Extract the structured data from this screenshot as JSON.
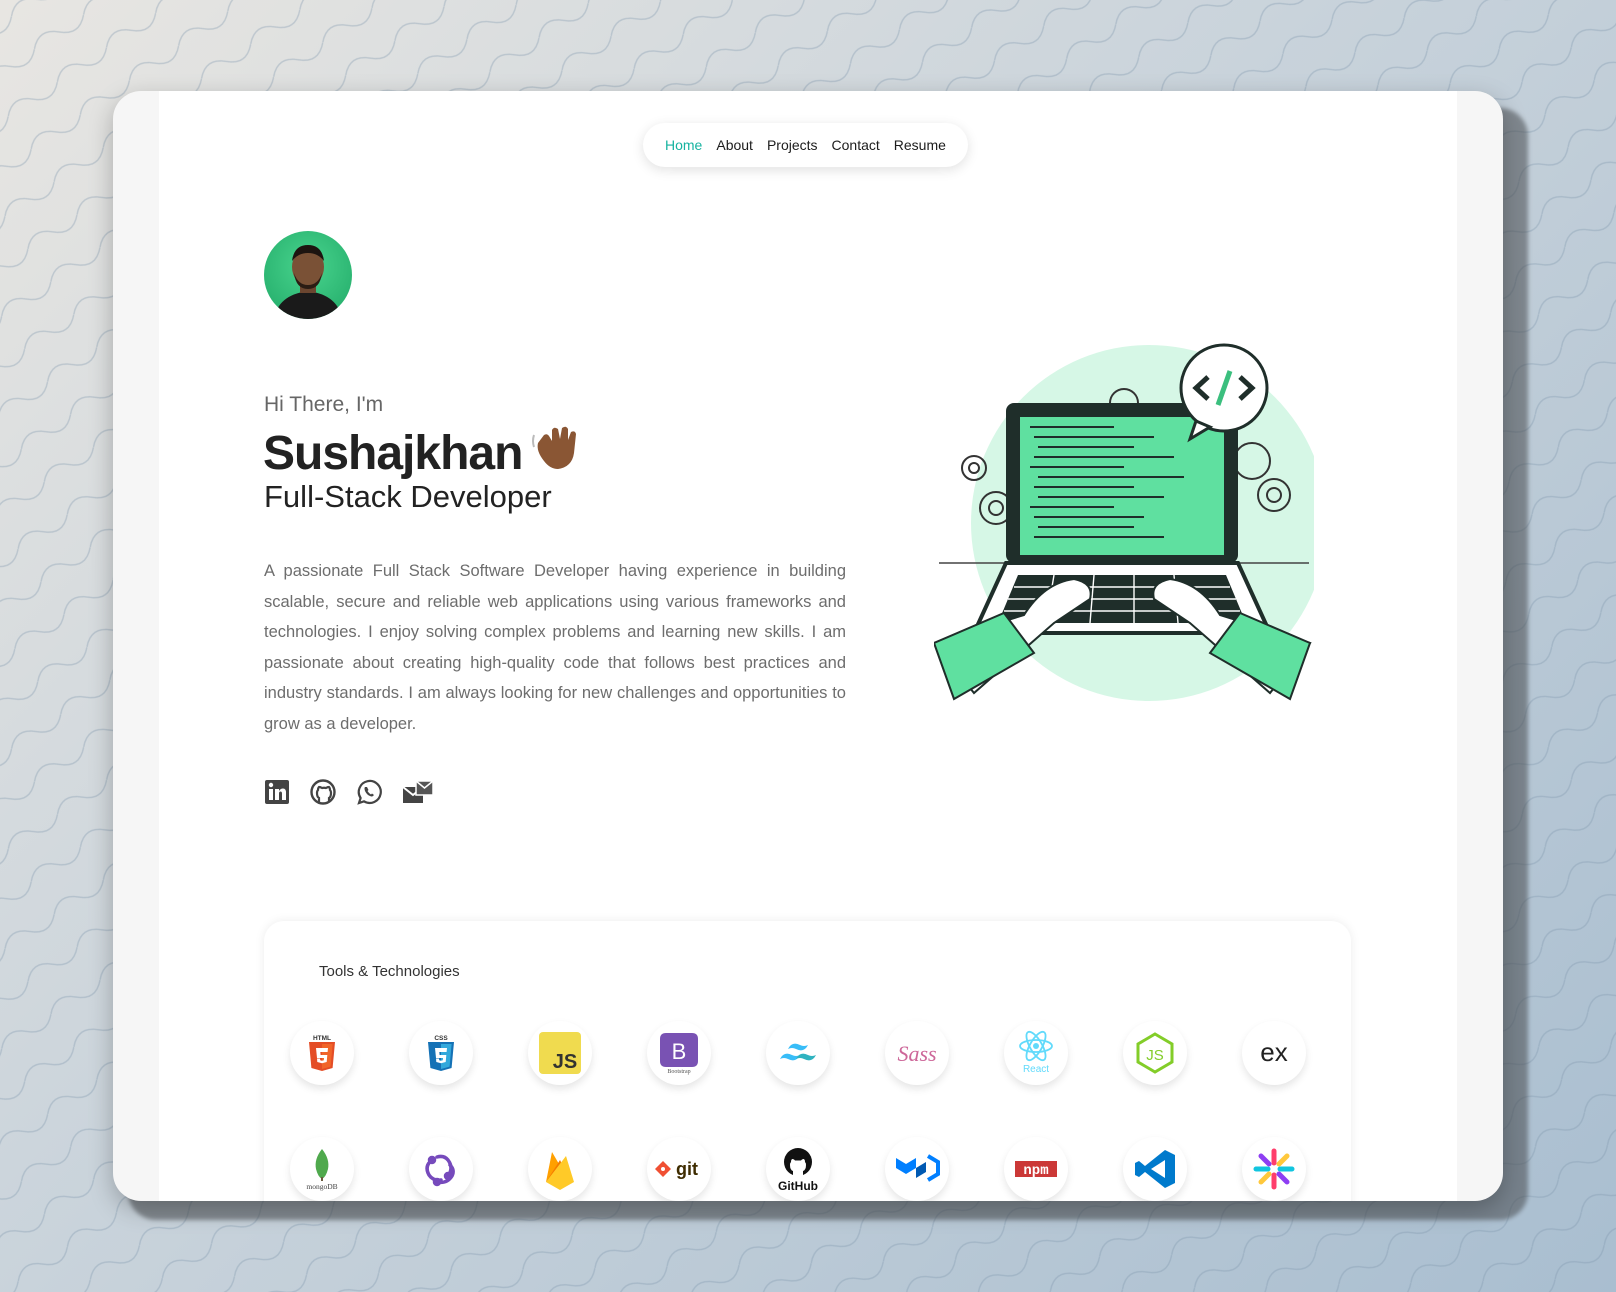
{
  "nav": {
    "items": [
      {
        "label": "Home",
        "active": true
      },
      {
        "label": "About"
      },
      {
        "label": "Projects"
      },
      {
        "label": "Contact"
      },
      {
        "label": "Resume"
      }
    ]
  },
  "hero": {
    "greeting": "Hi There, I'm",
    "name": "Sushajkhan",
    "role": "Full-Stack Developer",
    "bio": "A passionate Full Stack Software Developer having experience in building scalable, secure and reliable web applications using various frameworks and technologies. I enjoy solving complex problems and learning new skills. I am passionate about creating high-quality code that follows best practices and industry standards. I am always looking for new challenges and opportunities to grow as a developer."
  },
  "socials": [
    "linkedin-icon",
    "github-icon",
    "whatsapp-icon",
    "mail-icon"
  ],
  "tools": {
    "title": "Tools & Technologies",
    "row1": [
      "HTML",
      "CSS",
      "JS",
      "B",
      "tailwind",
      "Sass",
      "React",
      "JS",
      "ex"
    ],
    "row2": [
      "mongoDB",
      "redux",
      "firebase",
      "git",
      "GitHub",
      "material-ui",
      "npm",
      "vscode",
      "jest"
    ],
    "brand_labels": {
      "bootstrap": "Bootstrap"
    }
  },
  "colors": {
    "accent": "#16b3a0",
    "illustration_green": "#5fe0a0"
  }
}
